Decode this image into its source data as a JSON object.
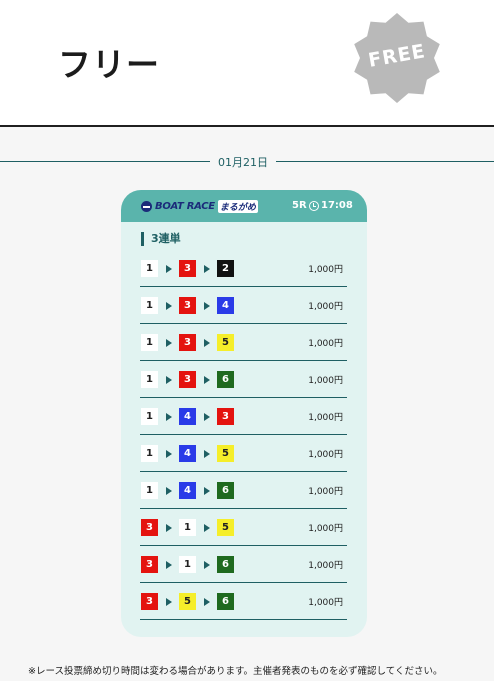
{
  "header": {
    "title": "フリー",
    "badge_text": "FREE",
    "badge_color": "#b9b9b9"
  },
  "date": "01月21日",
  "card": {
    "logo_text": "BOAT RACE",
    "logo_sub": "まるがめ",
    "race_no": "5R",
    "race_time": "17:08",
    "bet_type": "3連単",
    "rows": [
      {
        "first": "1",
        "second": "3",
        "third": "2",
        "amount": "1,000円"
      },
      {
        "first": "1",
        "second": "3",
        "third": "4",
        "amount": "1,000円"
      },
      {
        "first": "1",
        "second": "3",
        "third": "5",
        "amount": "1,000円"
      },
      {
        "first": "1",
        "second": "3",
        "third": "6",
        "amount": "1,000円"
      },
      {
        "first": "1",
        "second": "4",
        "third": "3",
        "amount": "1,000円"
      },
      {
        "first": "1",
        "second": "4",
        "third": "5",
        "amount": "1,000円"
      },
      {
        "first": "1",
        "second": "4",
        "third": "6",
        "amount": "1,000円"
      },
      {
        "first": "3",
        "second": "1",
        "third": "5",
        "amount": "1,000円"
      },
      {
        "first": "3",
        "second": "1",
        "third": "6",
        "amount": "1,000円"
      },
      {
        "first": "3",
        "second": "5",
        "third": "6",
        "amount": "1,000円"
      }
    ]
  },
  "footnote": "※レース投票締め切り時間は変わる場合があります。主催者発表のものを必ず確認してください。",
  "colors": {
    "accent": "#1e5f63",
    "card_header": "#5ab4ac",
    "card_bg": "#e1f3f1",
    "lane_1": "#ffffff",
    "lane_2": "#111111",
    "lane_3": "#e4130f",
    "lane_4": "#2a3be8",
    "lane_5": "#f5ee2a",
    "lane_6": "#1f6a1f"
  }
}
